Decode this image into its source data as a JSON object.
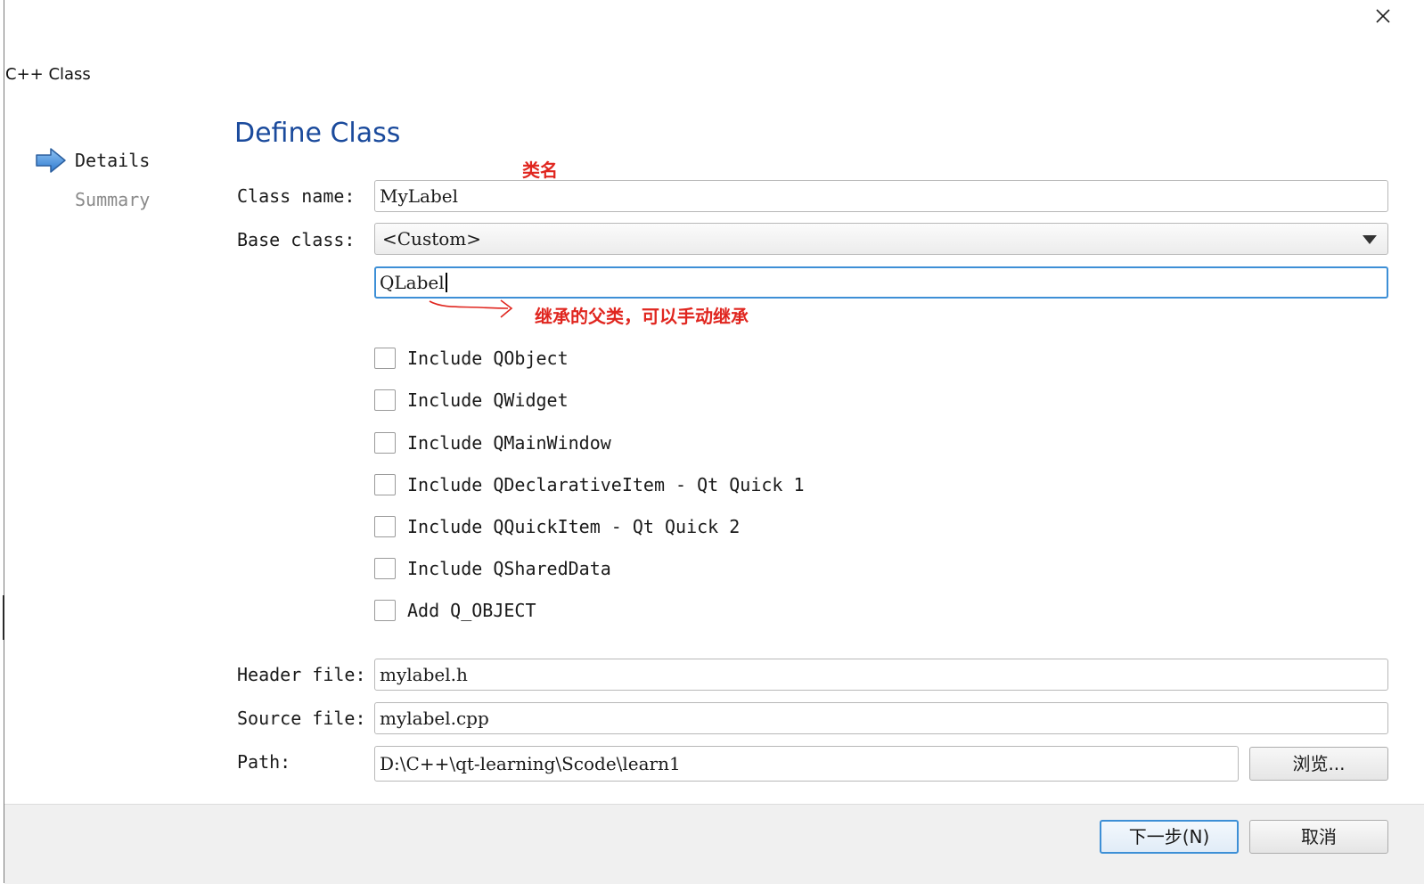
{
  "window": {
    "title": "C++ Class",
    "close_icon": "close-icon"
  },
  "steps": [
    {
      "label": "Details",
      "active": true
    },
    {
      "label": "Summary",
      "active": false
    }
  ],
  "page": {
    "title": "Define Class"
  },
  "form": {
    "class_name": {
      "label": "Class name:",
      "value": "MyLabel"
    },
    "base_class": {
      "label": "Base class:",
      "value": "<Custom>"
    },
    "custom_base": {
      "value": "QLabel"
    },
    "checkboxes": [
      {
        "label": "Include QObject",
        "checked": false
      },
      {
        "label": "Include QWidget",
        "checked": false
      },
      {
        "label": "Include QMainWindow",
        "checked": false
      },
      {
        "label": "Include QDeclarativeItem - Qt Quick 1",
        "checked": false
      },
      {
        "label": "Include QQuickItem - Qt Quick 2",
        "checked": false
      },
      {
        "label": "Include QSharedData",
        "checked": false
      },
      {
        "label": "Add Q_OBJECT",
        "checked": false
      }
    ],
    "header_file": {
      "label": "Header file:",
      "value": "mylabel.h"
    },
    "source_file": {
      "label": "Source file:",
      "value": "mylabel.cpp"
    },
    "path": {
      "label": "Path:",
      "value": "D:\\C++\\qt-learning\\Scode\\learn1"
    },
    "browse_label": "浏览..."
  },
  "annotations": {
    "class_name": "类名",
    "base_class": "继承的父类，可以手动继承"
  },
  "footer": {
    "next_label": "下一步(N)",
    "cancel_label": "取消"
  },
  "colors": {
    "accent": "#3d8fd6",
    "title": "#1a4a9c",
    "annotation": "#e0261f"
  }
}
